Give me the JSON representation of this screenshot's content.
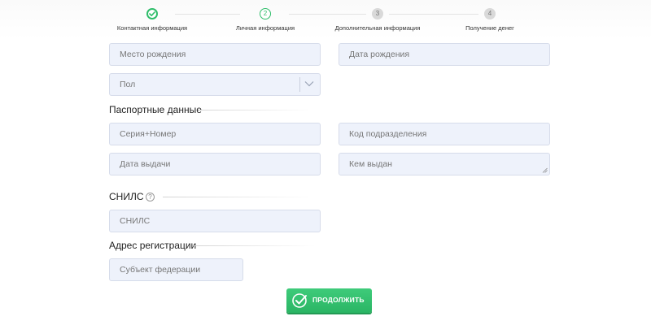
{
  "steps": [
    {
      "number": "1",
      "label": "Контактная информация",
      "state": "done"
    },
    {
      "number": "2",
      "label": "Личная информация",
      "state": "active"
    },
    {
      "number": "3",
      "label": "Дополнительная информация",
      "state": "inactive"
    },
    {
      "number": "4",
      "label": "Получение денег",
      "state": "inactive"
    }
  ],
  "personal": {
    "birthplace_placeholder": "Место рождения",
    "birthdate_placeholder": "Дата рождения",
    "gender_placeholder": "Пол"
  },
  "passport": {
    "title": "Паспортные данные",
    "series_number_placeholder": "Серия+Номер",
    "division_code_placeholder": "Код подразделения",
    "issue_date_placeholder": "Дата выдачи",
    "issued_by_placeholder": "Кем выдан"
  },
  "snils": {
    "title": "СНИЛС",
    "help_icon_glyph": "?",
    "placeholder": "СНИЛС"
  },
  "address": {
    "title": "Адрес регистрации",
    "region_placeholder": "Субъект федерации"
  },
  "continue_button": {
    "label": "ПРОДОЛЖИТЬ"
  },
  "colors": {
    "accent": "#2fbd6a",
    "field_bg": "#eef2fb",
    "field_border": "#d6dcea"
  },
  "icons": {
    "step1": "check-icon",
    "select": "chevron-down-icon",
    "help": "question-icon",
    "button": "check-circle-icon"
  }
}
